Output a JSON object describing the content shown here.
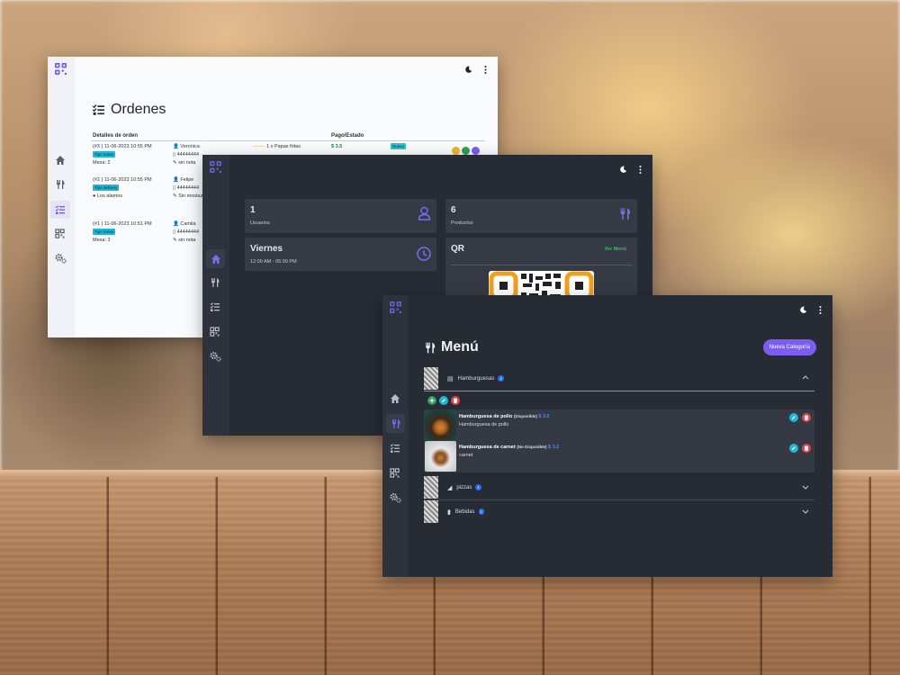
{
  "colors": {
    "accent": "#7b5ef0",
    "green": "#1a8a3c",
    "cyan": "#1fb6d8",
    "red": "#e0474c",
    "blue_badge": "#2a6cf0"
  },
  "orders_window": {
    "title": "Ordenes",
    "headers": [
      "Detalles de orden",
      "",
      "",
      "Pago/Estado",
      "",
      ""
    ],
    "rows": [
      {
        "detail": "(#3 ) 11-06-2023 10:55 PM",
        "type": "Tipo mesa",
        "place": "Mesa: 2",
        "customer": "Veronica",
        "phone": "44444444",
        "note": "sin nota",
        "item": "1 x Papas fritas",
        "price": "$ 3.5",
        "status": "Nuevo"
      },
      {
        "detail": "(#2 ) 11-06-2023 10:55 PM",
        "type": "Tipo delivery",
        "place": "Los alamos",
        "customer": "Felipe",
        "phone": "44444444",
        "note": "Sin mostaz",
        "item": "",
        "price": "",
        "status": ""
      },
      {
        "detail": "(#1 ) 11-06-2023 10:51 PM",
        "type": "Tipo mesa",
        "place": "Mesa: 3",
        "customer": "Camila",
        "phone": "44444444",
        "note": "sin nota",
        "item": "",
        "price": "",
        "status": ""
      }
    ]
  },
  "dashboard_window": {
    "users": {
      "count": "1",
      "label": "Usuarios"
    },
    "products": {
      "count": "6",
      "label": "Productos"
    },
    "schedule": {
      "day": "Viernes",
      "hours": "12:00 AM - 05:00 PM"
    },
    "qr": {
      "title": "QR",
      "link": "Ver Menú"
    }
  },
  "menu_window": {
    "title": "Menú",
    "new_category_button": "Nueva Categoría",
    "categories": [
      {
        "name": "Hamburguesas",
        "count": "2",
        "icon": "burger-icon"
      },
      {
        "name": "pizzas",
        "count": "1",
        "icon": "pizza-icon"
      },
      {
        "name": "Bebidas",
        "count": "1",
        "icon": "bottle-icon"
      }
    ],
    "products": [
      {
        "name": "Hamburguesa de pollo",
        "status": "(Disponible)",
        "price": "$ 3.5",
        "description": "Hamburguesa de pollo"
      },
      {
        "name": "Hamburguesa de carnet",
        "status": "(No Disponible)",
        "price": "$ 3.2",
        "description": "carnet"
      }
    ]
  }
}
